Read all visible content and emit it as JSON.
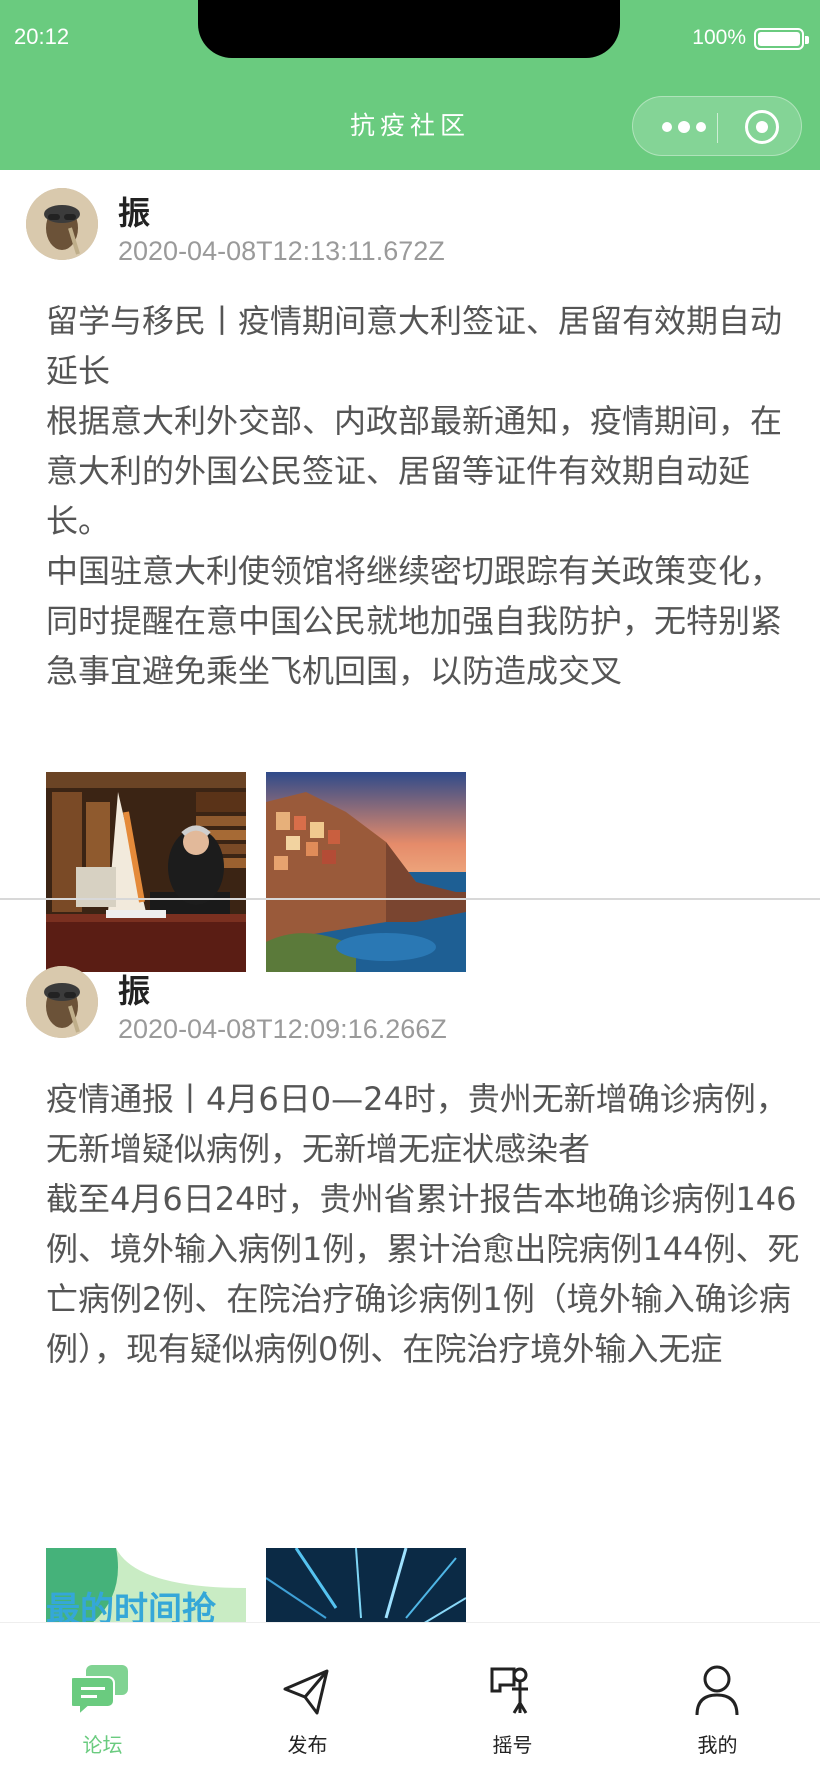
{
  "status_bar": {
    "time": "20:12",
    "battery": "100%"
  },
  "header": {
    "title": "抗疫社区"
  },
  "posts": [
    {
      "author": "振",
      "timestamp": "2020-04-08T12:13:11.672Z",
      "lines": [
        "留学与移民丨疫情期间意大利签证、居留有效期自动延长",
        "根据意大利外交部、内政部最新通知，疫情期间，在意大利的外国公民签证、居留等证件有效期自动延长。",
        "中国驻意大利使领馆将继续密切跟踪有关政策变化，同时提醒在意中国公民就地加强自我防护，无特别紧急事宜避免乘坐飞机回国，以防造成交叉"
      ]
    },
    {
      "author": "振",
      "timestamp": "2020-04-08T12:09:16.266Z",
      "lines": [
        "疫情通报丨4月6日0—24时，贵州无新增确诊病例，无新增疑似病例，无新增无症状感染者",
        "截至4月6日24时，贵州省累计报告本地确诊病例146例、境外输入病例1例，累计治愈出院病例144例、死亡病例2例、在院治疗确诊病例1例（境外输入确诊病例），现有疑似病例0例、在院治疗境外输入无症"
      ],
      "image_caption": "最的时间抢"
    }
  ],
  "tabbar": {
    "items": [
      {
        "label": "论坛",
        "icon": "forum-icon",
        "active": true
      },
      {
        "label": "发布",
        "icon": "send-icon",
        "active": false
      },
      {
        "label": "摇号",
        "icon": "lottery-icon",
        "active": false
      },
      {
        "label": "我的",
        "icon": "user-icon",
        "active": false
      }
    ]
  },
  "colors": {
    "accent": "#6acb7f",
    "text": "#555555",
    "muted": "#9a9a9a"
  }
}
